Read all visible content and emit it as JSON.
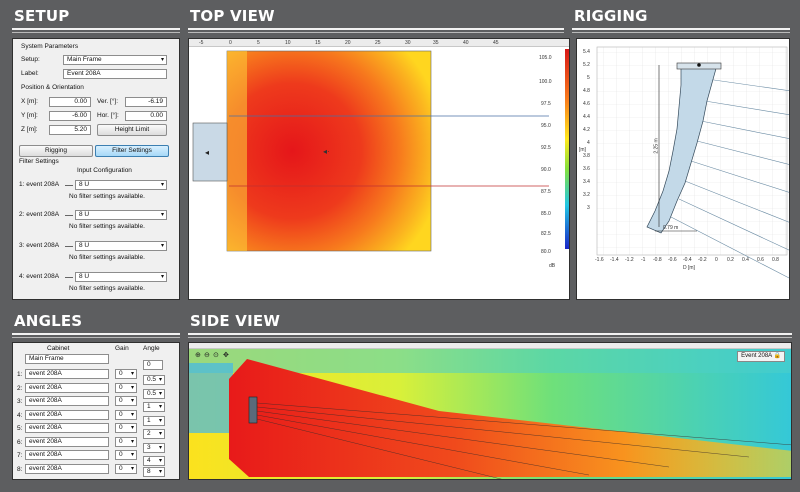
{
  "sections": {
    "setup": "SETUP",
    "top_view": "TOP VIEW",
    "rigging": "RIGGING",
    "angles": "ANGLES",
    "side_view": "SIDE VIEW"
  },
  "setup": {
    "system_parameters": "System Parameters",
    "setup_label": "Setup:",
    "setup_value": "Main Frame",
    "label_label": "Label:",
    "label_value": "Event 208A",
    "position_orientation": "Position & Orientation",
    "x_label": "X [m]:",
    "x_value": "0.00",
    "y_label": "Y [m]:",
    "y_value": "-6.00",
    "z_label": "Z [m]:",
    "z_value": "5.20",
    "ver_label": "Ver. [°]:",
    "ver_value": "-6.19",
    "hor_label": "Hor. [°]:",
    "hor_value": "0.00",
    "height_limit": "Height Limit",
    "rigging_tab": "Rigging",
    "filter_settings_tab": "Filter Settings",
    "filter_settings_title": "Filter Settings",
    "input_configuration": "Input Configuration",
    "filters": [
      {
        "label": "1: event 208A",
        "config": "8 U",
        "note": "No filter settings available."
      },
      {
        "label": "2: event 208A",
        "config": "8 U",
        "note": "No filter settings available."
      },
      {
        "label": "3: event 208A",
        "config": "8 U",
        "note": "No filter settings available."
      },
      {
        "label": "4: event 208A",
        "config": "8 U",
        "note": "No filter settings available."
      }
    ]
  },
  "top_view": {
    "ruler_ticks": [
      "-5",
      "0",
      "5",
      "10",
      "15",
      "20",
      "25",
      "30",
      "35",
      "40",
      "45"
    ],
    "scale_values": [
      "105.0",
      "100.0",
      "97.5",
      "95.0",
      "92.5",
      "90.0",
      "87.5",
      "85.0",
      "82.5",
      "80.0"
    ],
    "scale_unit": "dB"
  },
  "rigging": {
    "y_ticks": [
      "5.4",
      "5.2",
      "5",
      "4.8",
      "4.6",
      "4.4",
      "4.2",
      "4",
      "3.8",
      "3.6",
      "3.4",
      "3.2",
      "3"
    ],
    "x_ticks": [
      "-1.6",
      "-1.4",
      "-1.2",
      "-1",
      "-0.8",
      "-0.6",
      "-0.4",
      "-0.2",
      "0",
      "0.2",
      "0.4",
      "0.6",
      "0.8"
    ],
    "x_axis_label": "D [m]",
    "y_axis_label": "[m]",
    "dim_height": "2.25 m",
    "dim_width": "0.79 m"
  },
  "angles": {
    "col_cabinet": "Cabinet",
    "col_gain": "Gain",
    "col_angle": "Angle",
    "frame_label": "Main Frame",
    "frame_angle": "0",
    "rows": [
      {
        "num": "1:",
        "cabinet": "event 208A",
        "gain": "0",
        "angle": "0.5"
      },
      {
        "num": "2:",
        "cabinet": "event 208A",
        "gain": "0",
        "angle": "0.5"
      },
      {
        "num": "3:",
        "cabinet": "event 208A",
        "gain": "0",
        "angle": "1"
      },
      {
        "num": "4:",
        "cabinet": "event 208A",
        "gain": "0",
        "angle": "1"
      },
      {
        "num": "5:",
        "cabinet": "event 208A",
        "gain": "0",
        "angle": "2"
      },
      {
        "num": "6:",
        "cabinet": "event 208A",
        "gain": "0",
        "angle": "3"
      },
      {
        "num": "7:",
        "cabinet": "event 208A",
        "gain": "0",
        "angle": "4"
      },
      {
        "num": "8:",
        "cabinet": "event 208A",
        "gain": "0",
        "angle": "8"
      }
    ]
  },
  "side_view": {
    "badge": "Event 208A",
    "colors": {
      "hot": "#e81a1a",
      "warm": "#ffd21e",
      "cool": "#20c8e8"
    }
  }
}
